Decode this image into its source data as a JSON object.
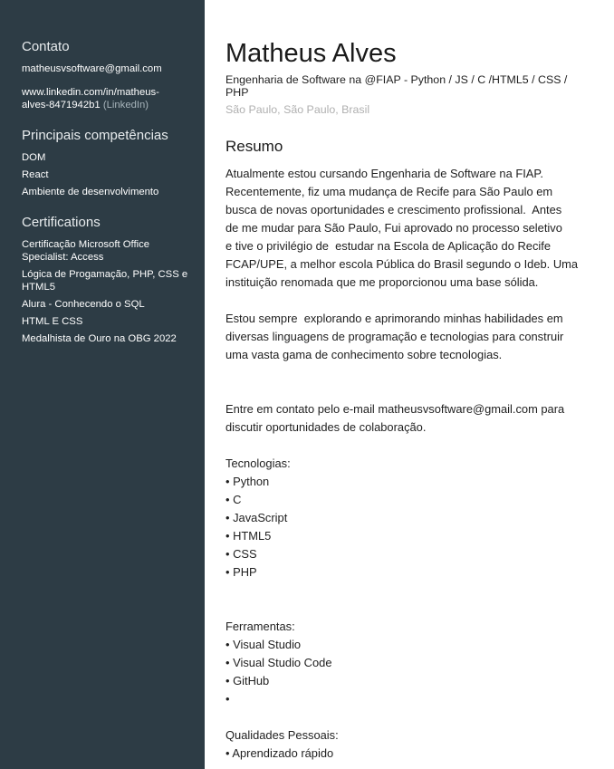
{
  "sidebar": {
    "contact_heading": "Contato",
    "email": "matheusvsoftware@gmail.com",
    "linkedin_line1": "www.linkedin.com/in/matheus-",
    "linkedin_line2": "alves-8471942b1",
    "linkedin_suffix": "(LinkedIn)",
    "skills_heading": "Principais competências",
    "skills": [
      "DOM",
      "React",
      "Ambiente de desenvolvimento"
    ],
    "certs_heading": "Certifications",
    "certifications": [
      [
        "Certificação Microsoft Office",
        "Specialist: Access"
      ],
      [
        "Lógica de Progamação, PHP, CSS e",
        "HTML5"
      ],
      [
        "Alura - Conhecendo o SQL"
      ],
      [
        "HTML E CSS"
      ],
      [
        "Medalhista de Ouro na OBG 2022"
      ]
    ]
  },
  "main": {
    "name": "Matheus Alves",
    "headline_line1": "Engenharia de Software na @FIAP - Python / JS / C /HTML5 / CSS /",
    "headline_line2": "PHP",
    "location": "São Paulo, São Paulo, Brasil",
    "summary_title": "Resumo",
    "summary_lines": [
      "Atualmente estou cursando Engenharia de Software na FIAP.",
      "Recentemente, fiz uma mudança de Recife para São Paulo em",
      "busca de novas oportunidades e crescimento profissional.  Antes",
      "de me mudar para São Paulo, Fui aprovado no processo seletivo",
      "e tive o privilégio de  estudar na Escola de Aplicação do Recife",
      "FCAP/UPE, a melhor escola Pública do Brasil segundo o Ideb. Uma",
      "instituição renomada que me proporcionou uma base sólida.",
      "",
      "Estou sempre  explorando e aprimorando minhas habilidades em",
      "diversas linguagens de programação e tecnologias para construir",
      "uma vasta gama de conhecimento sobre tecnologias.",
      "",
      "",
      "Entre em contato pelo e-mail matheusvsoftware@gmail.com para",
      "discutir oportunidades de colaboração.",
      "",
      "Tecnologias:",
      "• Python",
      "• C",
      "• JavaScript",
      "• HTML5",
      "• CSS",
      "• PHP",
      "",
      "",
      "Ferramentas:",
      "• Visual Studio",
      "• Visual Studio Code",
      "• GitHub",
      "•",
      "",
      "Qualidades Pessoais:",
      "• Aprendizado rápido"
    ]
  }
}
